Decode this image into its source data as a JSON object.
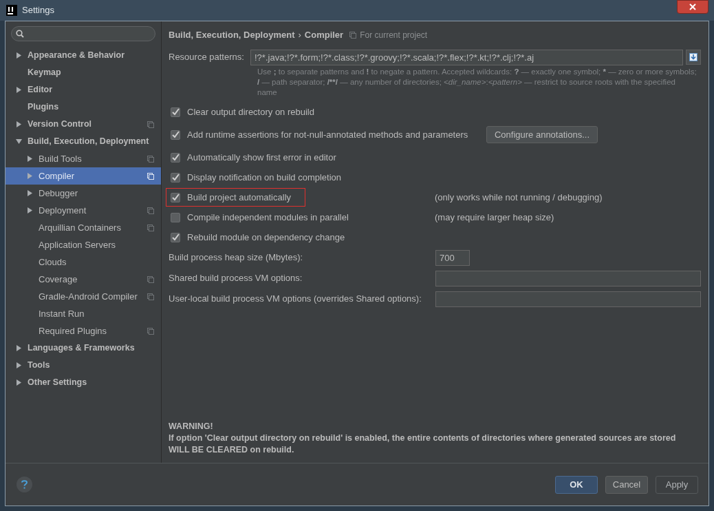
{
  "window": {
    "title": "Settings"
  },
  "sidebar": {
    "items": [
      {
        "label": "Appearance & Behavior",
        "expandable": true,
        "expanded": false,
        "selected": false,
        "per_project": false
      },
      {
        "label": "Keymap",
        "expandable": false,
        "selected": false,
        "per_project": false
      },
      {
        "label": "Editor",
        "expandable": true,
        "expanded": false,
        "selected": false,
        "per_project": false
      },
      {
        "label": "Plugins",
        "expandable": false,
        "selected": false,
        "per_project": false
      },
      {
        "label": "Version Control",
        "expandable": true,
        "expanded": false,
        "selected": false,
        "per_project": true
      },
      {
        "label": "Build, Execution, Deployment",
        "expandable": true,
        "expanded": true,
        "selected": false,
        "per_project": false,
        "children": [
          {
            "label": "Build Tools",
            "expandable": true,
            "expanded": false,
            "selected": false,
            "per_project": true
          },
          {
            "label": "Compiler",
            "expandable": true,
            "expanded": false,
            "selected": true,
            "per_project": true
          },
          {
            "label": "Debugger",
            "expandable": true,
            "expanded": false,
            "selected": false,
            "per_project": false
          },
          {
            "label": "Deployment",
            "expandable": true,
            "expanded": false,
            "selected": false,
            "per_project": true
          },
          {
            "label": "Arquillian Containers",
            "expandable": false,
            "selected": false,
            "per_project": true
          },
          {
            "label": "Application Servers",
            "expandable": false,
            "selected": false,
            "per_project": false
          },
          {
            "label": "Clouds",
            "expandable": false,
            "selected": false,
            "per_project": false
          },
          {
            "label": "Coverage",
            "expandable": false,
            "selected": false,
            "per_project": true
          },
          {
            "label": "Gradle-Android Compiler",
            "expandable": false,
            "selected": false,
            "per_project": true
          },
          {
            "label": "Instant Run",
            "expandable": false,
            "selected": false,
            "per_project": false
          },
          {
            "label": "Required Plugins",
            "expandable": false,
            "selected": false,
            "per_project": true
          }
        ]
      },
      {
        "label": "Languages & Frameworks",
        "expandable": true,
        "expanded": false,
        "selected": false,
        "per_project": false
      },
      {
        "label": "Tools",
        "expandable": true,
        "expanded": false,
        "selected": false,
        "per_project": false
      },
      {
        "label": "Other Settings",
        "expandable": true,
        "expanded": false,
        "selected": false,
        "per_project": false
      }
    ]
  },
  "breadcrumb": {
    "parent": "Build, Execution, Deployment",
    "separator": "›",
    "current": "Compiler",
    "scope": "For current project"
  },
  "resource_patterns": {
    "label": "Resource patterns:",
    "value": "!?*.java;!?*.form;!?*.class;!?*.groovy;!?*.scala;!?*.flex;!?*.kt;!?*.clj;!?*.aj",
    "hint": [
      {
        "text": "Use ",
        "kind": "plain"
      },
      {
        "text": ";",
        "kind": "bold"
      },
      {
        "text": " to separate patterns and ",
        "kind": "plain"
      },
      {
        "text": "!",
        "kind": "bold"
      },
      {
        "text": " to negate a pattern. Accepted wildcards: ",
        "kind": "plain"
      },
      {
        "text": "?",
        "kind": "bold"
      },
      {
        "text": " — exactly one symbol; ",
        "kind": "plain"
      },
      {
        "text": "*",
        "kind": "bold"
      },
      {
        "text": " — zero or more symbols; ",
        "kind": "plain"
      },
      {
        "text": "/",
        "kind": "bold"
      },
      {
        "text": " — path separator; ",
        "kind": "plain"
      },
      {
        "text": "/**/",
        "kind": "bold"
      },
      {
        "text": " — any number of directories; ",
        "kind": "plain"
      },
      {
        "text": "<dir_name>",
        "kind": "italic"
      },
      {
        "text": ":",
        "kind": "plain"
      },
      {
        "text": "<pattern>",
        "kind": "italic"
      },
      {
        "text": " — restrict to source roots with the specified name",
        "kind": "plain"
      }
    ]
  },
  "options": [
    {
      "label": "Clear output directory on rebuild",
      "checked": true,
      "highlighted": false
    },
    {
      "label": "Add runtime assertions for not-null-annotated methods and parameters",
      "checked": true,
      "highlighted": false,
      "button": "Configure annotations..."
    },
    {
      "label": "Automatically show first error in editor",
      "checked": true,
      "highlighted": false
    },
    {
      "label": "Display notification on build completion",
      "checked": true,
      "highlighted": false
    },
    {
      "label": "Build project automatically",
      "checked": true,
      "highlighted": true,
      "note": "(only works while not running / debugging)"
    },
    {
      "label": "Compile independent modules in parallel",
      "checked": false,
      "highlighted": false,
      "note": "(may require larger heap size)"
    },
    {
      "label": "Rebuild module on dependency change",
      "checked": true,
      "highlighted": false
    }
  ],
  "fields": [
    {
      "label": "Build process heap size (Mbytes):",
      "value": "700",
      "kind": "short"
    },
    {
      "label": "Shared build process VM options:",
      "kind": "wide"
    },
    {
      "label": "User-local build process VM options (overrides Shared options):",
      "kind": "wide"
    }
  ],
  "warning": {
    "title": "WARNING!",
    "lines": [
      "If option 'Clear output directory on rebuild' is enabled, the entire contents of directories where generated sources are stored",
      "WILL BE CLEARED on rebuild."
    ]
  },
  "buttons": [
    {
      "label": "OK",
      "kind": "default",
      "disabled": false
    },
    {
      "label": "Cancel",
      "kind": "normal",
      "disabled": false
    },
    {
      "label": "Apply",
      "kind": "normal",
      "disabled": true
    }
  ]
}
